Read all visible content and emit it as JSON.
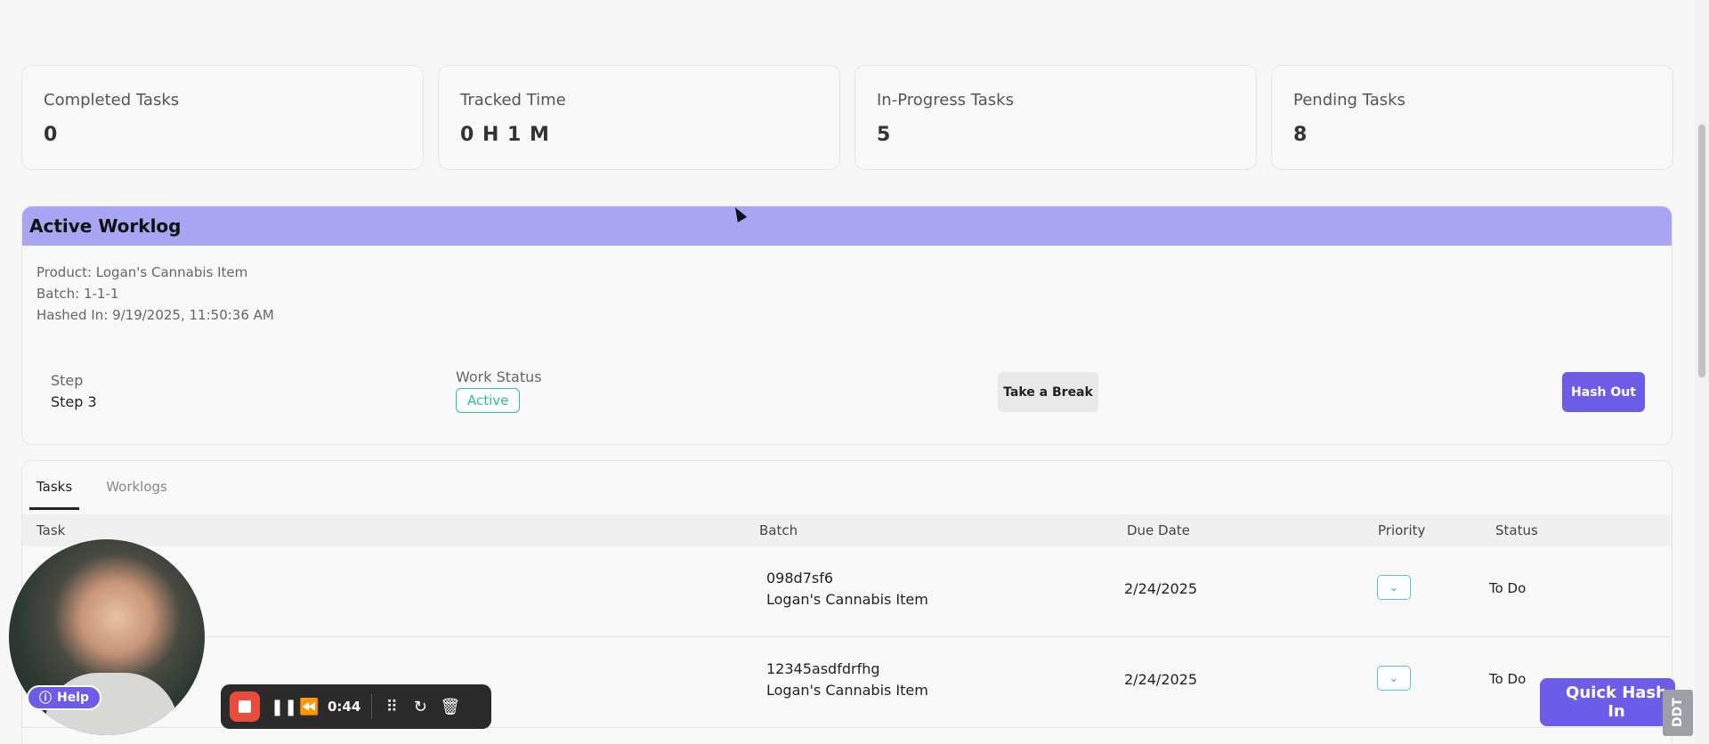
{
  "stats": [
    {
      "label": "Completed Tasks",
      "value": "0"
    },
    {
      "label": "Tracked Time",
      "value": "0 H 1 M"
    },
    {
      "label": "In-Progress Tasks",
      "value": "5"
    },
    {
      "label": "Pending Tasks",
      "value": "8"
    }
  ],
  "worklog": {
    "title": "Active Worklog",
    "product": "Product: Logan's Cannabis Item",
    "batch": "Batch: 1-1-1",
    "hashed_in": "Hashed In: 9/19/2025, 11:50:36 AM",
    "step_label": "Step",
    "step_value": "Step 3",
    "work_status_label": "Work Status",
    "work_status": "Active",
    "break_button": "Take a Break",
    "hash_out_button": "Hash Out"
  },
  "tabs": [
    {
      "label": "Tasks",
      "active": true
    },
    {
      "label": "Worklogs",
      "active": false
    }
  ],
  "table": {
    "columns": [
      "Task",
      "Batch",
      "Due Date",
      "Priority",
      "Status"
    ],
    "rows": [
      {
        "batch_id": "098d7sf6",
        "batch_product": "Logan's Cannabis Item",
        "due": "2/24/2025",
        "status": "To Do"
      },
      {
        "batch_id": "12345asdfdrfhg",
        "batch_product": "Logan's Cannabis Item",
        "due": "2/24/2025",
        "status": "To Do"
      }
    ]
  },
  "recorder": {
    "time": "0:44",
    "icons": [
      "stop-icon",
      "pause-icon",
      "rewind-icon",
      "grid-icon",
      "restart-icon",
      "trash-icon"
    ]
  },
  "help_label": "Help",
  "quick_hash_label": "Quick Hash In",
  "logo_text": "DDT",
  "colors": {
    "accent": "#6c5ce7",
    "worklog_header": "#aaa5f3",
    "active_status": "#2bbf8a",
    "record_stop": "#e74c3c"
  }
}
